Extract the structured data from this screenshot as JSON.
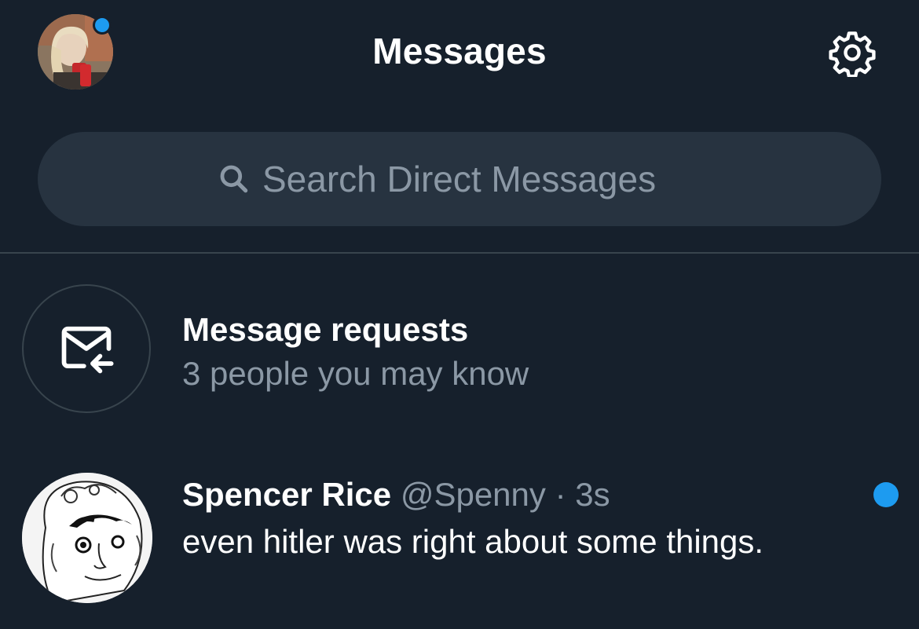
{
  "header": {
    "title": "Messages",
    "avatar_icon": "user-avatar-photo",
    "settings_icon": "gear-icon"
  },
  "search": {
    "placeholder": "Search Direct Messages",
    "icon": "search-icon"
  },
  "message_requests": {
    "title": "Message requests",
    "subtitle": "3 people you may know",
    "icon": "envelope-arrow-icon"
  },
  "conversations": [
    {
      "name": "Spencer Rice",
      "handle": "@Spenny",
      "separator": "·",
      "time": "3s",
      "message": "even hitler was right about some things.",
      "unread": true
    }
  ],
  "colors": {
    "background": "#16202c",
    "accent": "#1d9bf0",
    "muted_text": "#8b98a5",
    "search_bg": "#273340",
    "border": "#38444d"
  }
}
